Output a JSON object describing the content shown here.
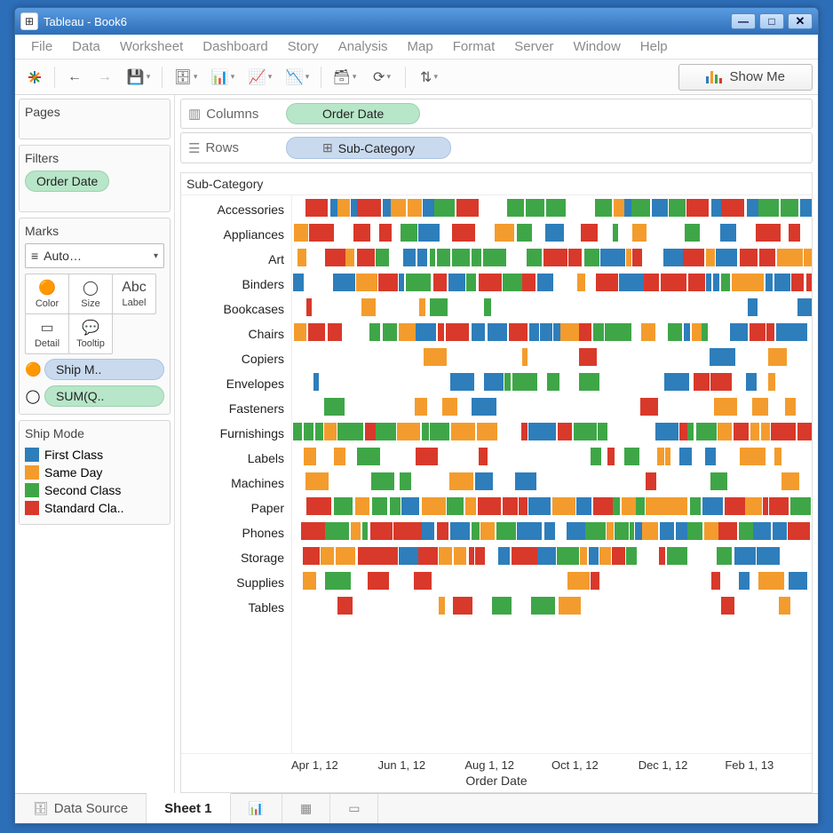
{
  "window": {
    "title": "Tableau - Book6"
  },
  "menu": [
    "File",
    "Data",
    "Worksheet",
    "Dashboard",
    "Story",
    "Analysis",
    "Map",
    "Format",
    "Server",
    "Window",
    "Help"
  ],
  "toolbar": {
    "show_me_label": "Show Me"
  },
  "shelves": {
    "columns_label": "Columns",
    "rows_label": "Rows",
    "columns_pill": "Order Date",
    "rows_pill": "Sub-Category"
  },
  "pages_label": "Pages",
  "filters": {
    "label": "Filters",
    "pill": "Order Date"
  },
  "marks": {
    "label": "Marks",
    "type": "Auto…",
    "cells": [
      "Color",
      "Size",
      "Label",
      "Detail",
      "Tooltip"
    ],
    "pills": [
      {
        "kind": "color",
        "label": "Ship M.."
      },
      {
        "kind": "size",
        "label": "SUM(Q.."
      }
    ]
  },
  "legend": {
    "title": "Ship Mode",
    "items": [
      {
        "label": "First Class",
        "color": "#2e7ebb"
      },
      {
        "label": "Same Day",
        "color": "#f39c2d"
      },
      {
        "label": "Second Class",
        "color": "#3fa648"
      },
      {
        "label": "Standard Cla..",
        "color": "#d8392b"
      }
    ]
  },
  "viz": {
    "category_label": "Sub-Category",
    "axis_label": "Order Date",
    "subcategories": [
      "Accessories",
      "Appliances",
      "Art",
      "Binders",
      "Bookcases",
      "Chairs",
      "Copiers",
      "Envelopes",
      "Fasteners",
      "Furnishings",
      "Labels",
      "Machines",
      "Paper",
      "Phones",
      "Storage",
      "Supplies",
      "Tables"
    ],
    "xticks": [
      "Apr 1, 12",
      "Jun 1, 12",
      "Aug 1, 12",
      "Oct 1, 12",
      "Dec 1, 12",
      "Feb 1, 13"
    ]
  },
  "bottom": {
    "data_source": "Data Source",
    "sheet": "Sheet 1"
  },
  "chart_data": {
    "type": "bar",
    "title": "Sub-Category",
    "xlabel": "Order Date",
    "ylabel": "Sub-Category",
    "x_range": [
      "2012-04-01",
      "2013-02-01"
    ],
    "color_field": "Ship Mode",
    "color_levels": [
      "First Class",
      "Same Day",
      "Second Class",
      "Standard Class"
    ],
    "color_map": {
      "First Class": "#2e7ebb",
      "Same Day": "#f39c2d",
      "Second Class": "#3fa648",
      "Standard Class": "#d8392b"
    },
    "size_field": "SUM(Quantity)",
    "note": "Gantt-style marks; per-row segments below are approximate positions (0–100% of x range) read from the screenshot."
  }
}
